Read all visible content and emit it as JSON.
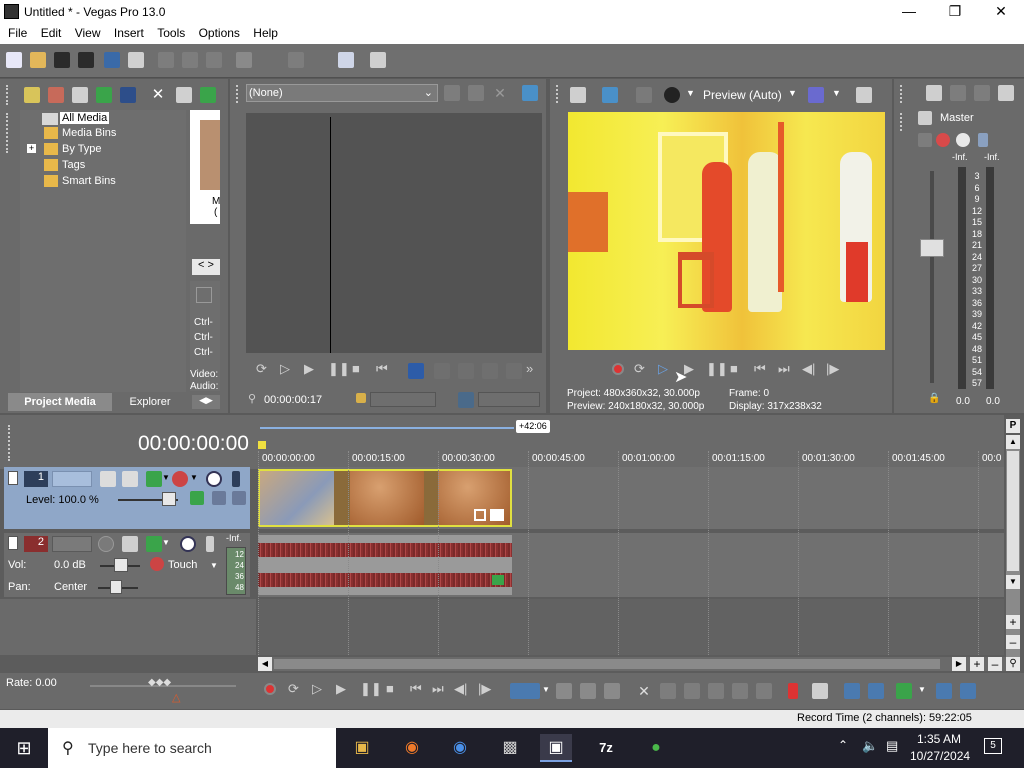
{
  "window": {
    "title": "Untitled * - Vegas Pro 13.0"
  },
  "menu": [
    "File",
    "Edit",
    "View",
    "Insert",
    "Tools",
    "Options",
    "Help"
  ],
  "project_media": {
    "tree": [
      "All Media",
      "Media Bins",
      "By Type",
      "Tags",
      "Smart Bins"
    ],
    "expand_glyph": "+",
    "thumb_label_1": "M",
    "thumb_label_2": "(",
    "nav": "< >",
    "ctrl_lines": [
      "Ctrl-",
      "Ctrl-",
      "Ctrl-"
    ],
    "video_label": "Video:",
    "audio_label": "Audio:",
    "tab_project_media": "Project Media",
    "tab_explorer": "Explorer"
  },
  "trimmer": {
    "select_value": "(None)",
    "timecode": "00:00:00:17"
  },
  "preview": {
    "mode": "Preview (Auto)",
    "project_line": "Project:  480x360x32, 30.000p",
    "preview_line": "Preview:  240x180x32, 30.000p",
    "frame_line": "Frame:    0",
    "display_line": "Display:  317x238x32"
  },
  "master": {
    "label": "Master",
    "inf_left": "-Inf.",
    "inf_right": "-Inf.",
    "scale": [
      "3",
      "6",
      "9",
      "12",
      "15",
      "18",
      "21",
      "24",
      "27",
      "30",
      "33",
      "36",
      "39",
      "42",
      "45",
      "48",
      "51",
      "54",
      "57"
    ],
    "left_val": "0.0",
    "right_val": "0.0"
  },
  "timeline": {
    "timecode": "00:00:00:00",
    "marker": "+42:06",
    "ruler": [
      "00:00:00:00",
      "00:00:15:00",
      "00:00:30:00",
      "00:00:45:00",
      "00:01:00:00",
      "00:01:15:00",
      "00:01:30:00",
      "00:01:45:00",
      "00:0"
    ],
    "track1": {
      "number": "1",
      "level": "Level: 100.0 %"
    },
    "track2": {
      "number": "2",
      "vol_label": "Vol:",
      "vol_value": "0.0 dB",
      "pan_label": "Pan:",
      "pan_value": "Center",
      "touch": "Touch",
      "inf": "-Inf.",
      "meter_scale": [
        "12",
        "24",
        "36",
        "48"
      ]
    },
    "rate": "Rate: 0.00"
  },
  "status": {
    "record_time": "Record Time (2 channels): 59:22:05"
  },
  "scroll": {
    "p": "P"
  },
  "taskbar": {
    "search_placeholder": "Type here to search",
    "time": "1:35 AM",
    "date": "10/27/2024",
    "notif_count": "5"
  }
}
